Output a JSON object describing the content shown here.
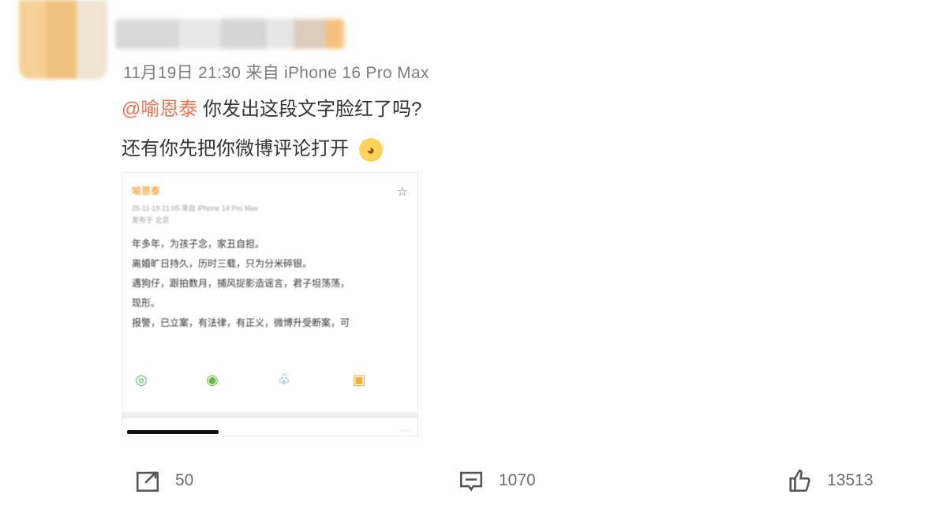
{
  "post": {
    "meta": "11月19日 21:30  来自 iPhone 16 Pro Max",
    "mention": "@喻恩泰",
    "text_line1": "你发出这段文字脸红了吗?",
    "text_line2": "还有你先把你微博评论打开"
  },
  "screenshot_card": {
    "user": "喻恩泰",
    "meta_line1": "25-11-19 21:05  来自 iPhone 14 Pro Max",
    "meta_line2": "发布于 北京",
    "lines": [
      "年多年，为孩子念，家丑自担。",
      "离婚旷日持久，历时三载，只为分米碎银。",
      "遇狗仔，跟拍数月，捕风捉影造谣言，君子坦荡荡，",
      "现形。",
      "报警，已立案，有法律，有正义，微博升受断案，可"
    ]
  },
  "actions": {
    "repost": "50",
    "comments": "1070",
    "likes": "13513"
  },
  "icons": {
    "repost": "repost-icon",
    "comment": "comment-icon",
    "like": "like-icon",
    "star": "star-icon",
    "wechat": "wechat-icon",
    "moments": "moments-icon",
    "qq": "qq-icon",
    "edit": "edit-icon"
  }
}
